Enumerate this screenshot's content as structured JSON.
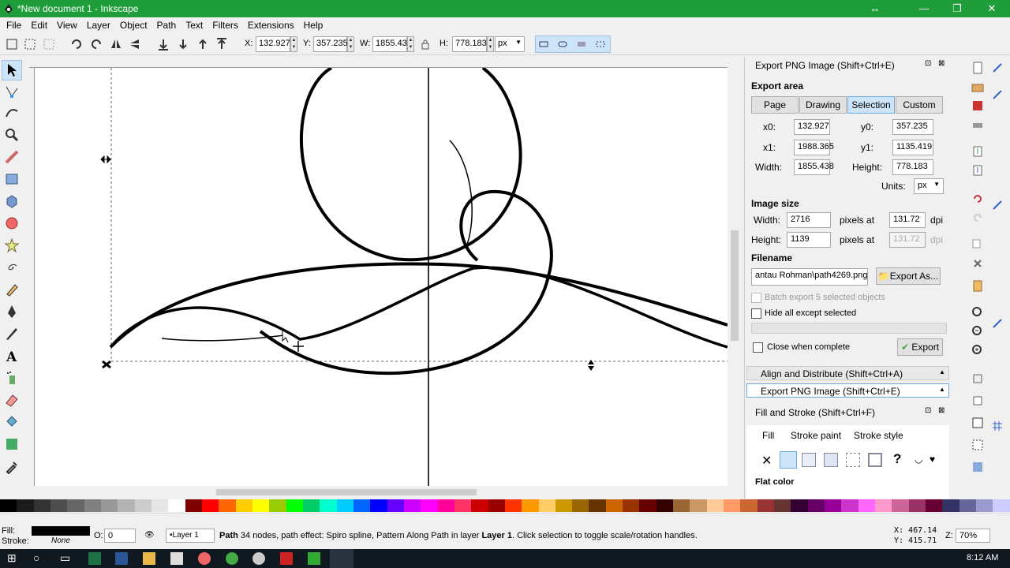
{
  "window": {
    "title": "*New document 1 - Inkscape",
    "minimize": "—",
    "maximize": "❐",
    "close": "✕",
    "resize": "↔"
  },
  "menu": [
    "File",
    "Edit",
    "View",
    "Layer",
    "Object",
    "Path",
    "Text",
    "Filters",
    "Extensions",
    "Help"
  ],
  "toolbar": {
    "x_label": "X:",
    "x_value": "132.927",
    "y_label": "Y:",
    "y_value": "357.235",
    "w_label": "W:",
    "w_value": "1855.43",
    "h_label": "H:",
    "h_value": "778.183",
    "unit": "px"
  },
  "export_panel": {
    "title": "Export PNG Image (Shift+Ctrl+E)",
    "export_area": "Export area",
    "area_buttons": [
      "Page",
      "Drawing",
      "Selection",
      "Custom"
    ],
    "selected_area": "Selection",
    "x0_label": "x0:",
    "x0": "132.927",
    "y0_label": "y0:",
    "y0": "357.235",
    "x1_label": "x1:",
    "x1": "1988.365",
    "y1_label": "y1:",
    "y1": "1135.419",
    "width_label": "Width:",
    "width": "1855.438",
    "height_label": "Height:",
    "height": "778.183",
    "units_label": "Units:",
    "units": "px",
    "image_size": "Image size",
    "img_width_label": "Width:",
    "img_width": "2716",
    "img_height_label": "Height:",
    "img_height": "1139",
    "pixels_at": "pixels at",
    "dpi1": "131.72",
    "dpi2": "131.72",
    "dpi": "dpi",
    "filename_label": "Filename",
    "filename": "antau Rohman\\path4269.png",
    "export_as": "Export As...",
    "batch": "Batch export 5 selected objects",
    "hide_all": "Hide all except selected",
    "close_when_complete": "Close when complete",
    "export": "Export"
  },
  "collapsed_panels": {
    "align": "Align and Distribute (Shift+Ctrl+A)",
    "export": "Export PNG Image (Shift+Ctrl+E)"
  },
  "fill_stroke": {
    "title": "Fill and Stroke (Shift+Ctrl+F)",
    "tabs": [
      "Fill",
      "Stroke paint",
      "Stroke style"
    ],
    "flat_color": "Flat color"
  },
  "status": {
    "fill_label": "Fill:",
    "stroke_label": "Stroke:",
    "stroke_value": "None",
    "opacity_label": "O:",
    "opacity_value": "0",
    "layer": "•Layer 1",
    "message_bold": "Path",
    "message": " 34 nodes, path effect: Spiro spline, Pattern Along Path in layer ",
    "message_layer": "Layer 1",
    "message_end": ". Click selection to toggle scale/rotation handles.",
    "x_coord": "X:  467.14",
    "y_coord": "Y:  415.71",
    "z_label": "Z:",
    "zoom": "70%"
  },
  "taskbar": {
    "time": "8:12 AM"
  },
  "colors": {
    "titlebar": "#1f9d3a",
    "selection_button": "#cde4f7",
    "taskbar": "#101820"
  },
  "palette": [
    "#000000",
    "#1a1a1a",
    "#333333",
    "#4d4d4d",
    "#666666",
    "#808080",
    "#999999",
    "#b3b3b3",
    "#cccccc",
    "#e6e6e6",
    "#ffffff",
    "#800000",
    "#ff0000",
    "#ff6600",
    "#ffcc00",
    "#ffff00",
    "#99cc00",
    "#00ff00",
    "#00cc66",
    "#00ffcc",
    "#00ccff",
    "#0066ff",
    "#0000ff",
    "#6600ff",
    "#cc00ff",
    "#ff00ff",
    "#ff0099",
    "#ff3366",
    "#cc0000",
    "#990000",
    "#ff3300",
    "#ff9900",
    "#ffcc66",
    "#cc9900",
    "#996600",
    "#663300",
    "#cc6600",
    "#993300",
    "#660000",
    "#330000",
    "#996633",
    "#cc9966",
    "#ffcc99",
    "#ff9966",
    "#cc6633",
    "#993333",
    "#663333",
    "#330033",
    "#660066",
    "#990099",
    "#cc33cc",
    "#ff66ff",
    "#ff99cc",
    "#cc6699",
    "#993366",
    "#660033",
    "#333366",
    "#666699",
    "#9999cc",
    "#ccccff"
  ]
}
